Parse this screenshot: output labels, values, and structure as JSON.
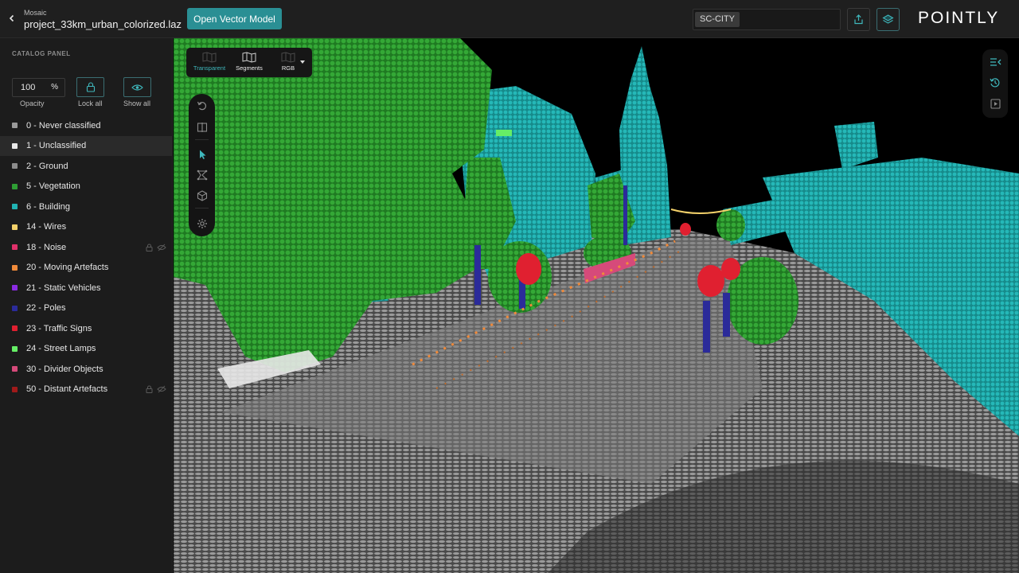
{
  "header": {
    "breadcrumb": "Mosaic",
    "file_name": "project_33km_urban_colorized.laz",
    "open_vector_label": "Open Vector Model",
    "search_tag": "SC-CITY",
    "logo": "POINTLY"
  },
  "sidebar": {
    "panel_title": "CATALOG PANEL",
    "opacity_value": "100",
    "opacity_unit": "%",
    "opacity_label": "Opacity",
    "lock_all_label": "Lock all",
    "show_all_label": "Show all",
    "classes": [
      {
        "label": "0 - Never classified",
        "color": "#9a9a9a"
      },
      {
        "label": "1 - Unclassified",
        "color": "#e8e8e8"
      },
      {
        "label": "2 - Ground",
        "color": "#8d8d8d"
      },
      {
        "label": "5 - Vegetation",
        "color": "#2e9e34"
      },
      {
        "label": "6 - Building",
        "color": "#20b3b3"
      },
      {
        "label": "14 - Wires",
        "color": "#f3d16a"
      },
      {
        "label": "18 - Noise",
        "color": "#e0306a"
      },
      {
        "label": "20 - Moving Artefacts",
        "color": "#f08a3a"
      },
      {
        "label": "21 - Static Vehicles",
        "color": "#8a2be2"
      },
      {
        "label": "22 - Poles",
        "color": "#2b2b9a"
      },
      {
        "label": "23 - Traffic Signs",
        "color": "#e02030"
      },
      {
        "label": "24 - Street Lamps",
        "color": "#66ee66"
      },
      {
        "label": "30 - Divider Objects",
        "color": "#d64a7a"
      },
      {
        "label": "50 - Distant Artefacts",
        "color": "#a01a1a"
      }
    ]
  },
  "viewport": {
    "modes": [
      {
        "label": "Transparent",
        "icon": "map-icon",
        "active": true
      },
      {
        "label": "Segments",
        "icon": "map-icon",
        "active": false
      },
      {
        "label": "RGB",
        "icon": "map-icon",
        "active": false
      }
    ]
  },
  "colors": {
    "accent": "#2a8f94",
    "vegetation": "#2f9a2f",
    "building": "#1fb0b0",
    "ground": "#8a8a8a"
  }
}
